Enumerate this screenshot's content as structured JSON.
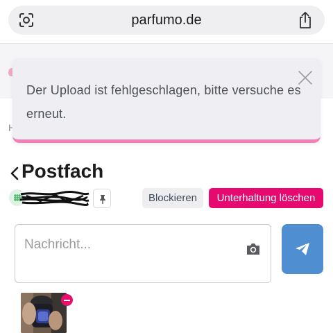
{
  "browser": {
    "url": "parfumo.de",
    "icons": {
      "left": "camera-lens-icon",
      "right": "share-icon"
    }
  },
  "toast": {
    "message": "Der Upload ist fehlgeschlagen, bitte versuche es erneut.",
    "close_icon": "close-icon",
    "accent_color": "#f080b5"
  },
  "breadcrumb": {
    "visible_fragment": "H"
  },
  "page": {
    "title": "Postfach",
    "back_icon": "chevron-left-icon"
  },
  "contact": {
    "name_redacted": true,
    "pin_icon": "pin-icon"
  },
  "actions": {
    "block_label": "Blockieren",
    "delete_label": "Unterhaltung löschen",
    "delete_color": "#e60a70"
  },
  "composer": {
    "placeholder": "Nachricht...",
    "camera_icon": "camera-icon",
    "send_icon": "paper-plane-icon",
    "send_color": "#4f8fd1"
  },
  "attachment": {
    "remove_icon": "minus-icon"
  }
}
